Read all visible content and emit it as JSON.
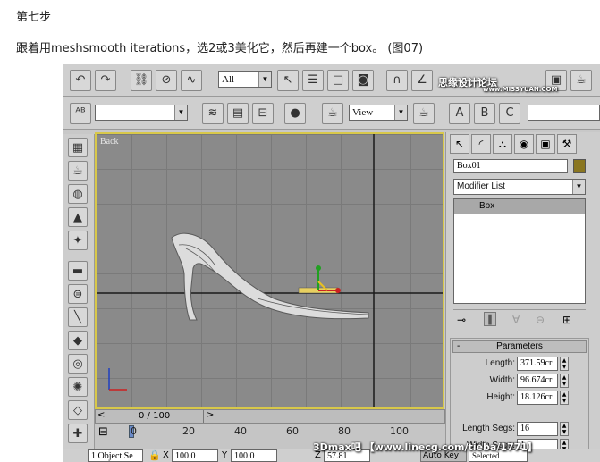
{
  "step_title": "第七步",
  "instruction": "跟着用meshsmooth iterations，选2或3美化它，然后再建一个box。 (图07)",
  "toolbar": {
    "selection_filter": "All",
    "view_dropdown": "View",
    "watermark_top": "思缘设计论坛",
    "watermark_site": "www.MISSYUAN.COM"
  },
  "viewport": {
    "label": "Back"
  },
  "command_panel": {
    "object_name": "Box01",
    "modifier_list": "Modifier List",
    "stack_item": "Box",
    "rollout_title": "Parameters",
    "params": [
      {
        "label": "Length:",
        "value": "371.59cr"
      },
      {
        "label": "Width:",
        "value": "96.674cr"
      },
      {
        "label": "Height:",
        "value": "18.126cr"
      },
      {
        "label": "Length Segs:",
        "value": "16"
      },
      {
        "label": "Width Segs:",
        "value": "1"
      }
    ],
    "param_minus": "-"
  },
  "timeline": {
    "frame_counter": "0 / 100",
    "ticks": [
      "0",
      "20",
      "40",
      "60",
      "80",
      "100"
    ]
  },
  "status": {
    "selection": "1 Object Se",
    "x_label": "X",
    "x_value": "100.0",
    "y_label": "Y",
    "y_value": "100.0",
    "z_label": "Z",
    "z_value": "57.81",
    "autokey": "Auto Key",
    "selected": "Selected"
  },
  "watermark_bottom": "3Dmax吧 【www.linecg.com/tieba/1771】",
  "colors": {
    "viewport_bg": "#8a8a8a",
    "viewport_border": "#d8c84a",
    "axis_red": "#cc2020",
    "axis_green": "#20a020"
  }
}
